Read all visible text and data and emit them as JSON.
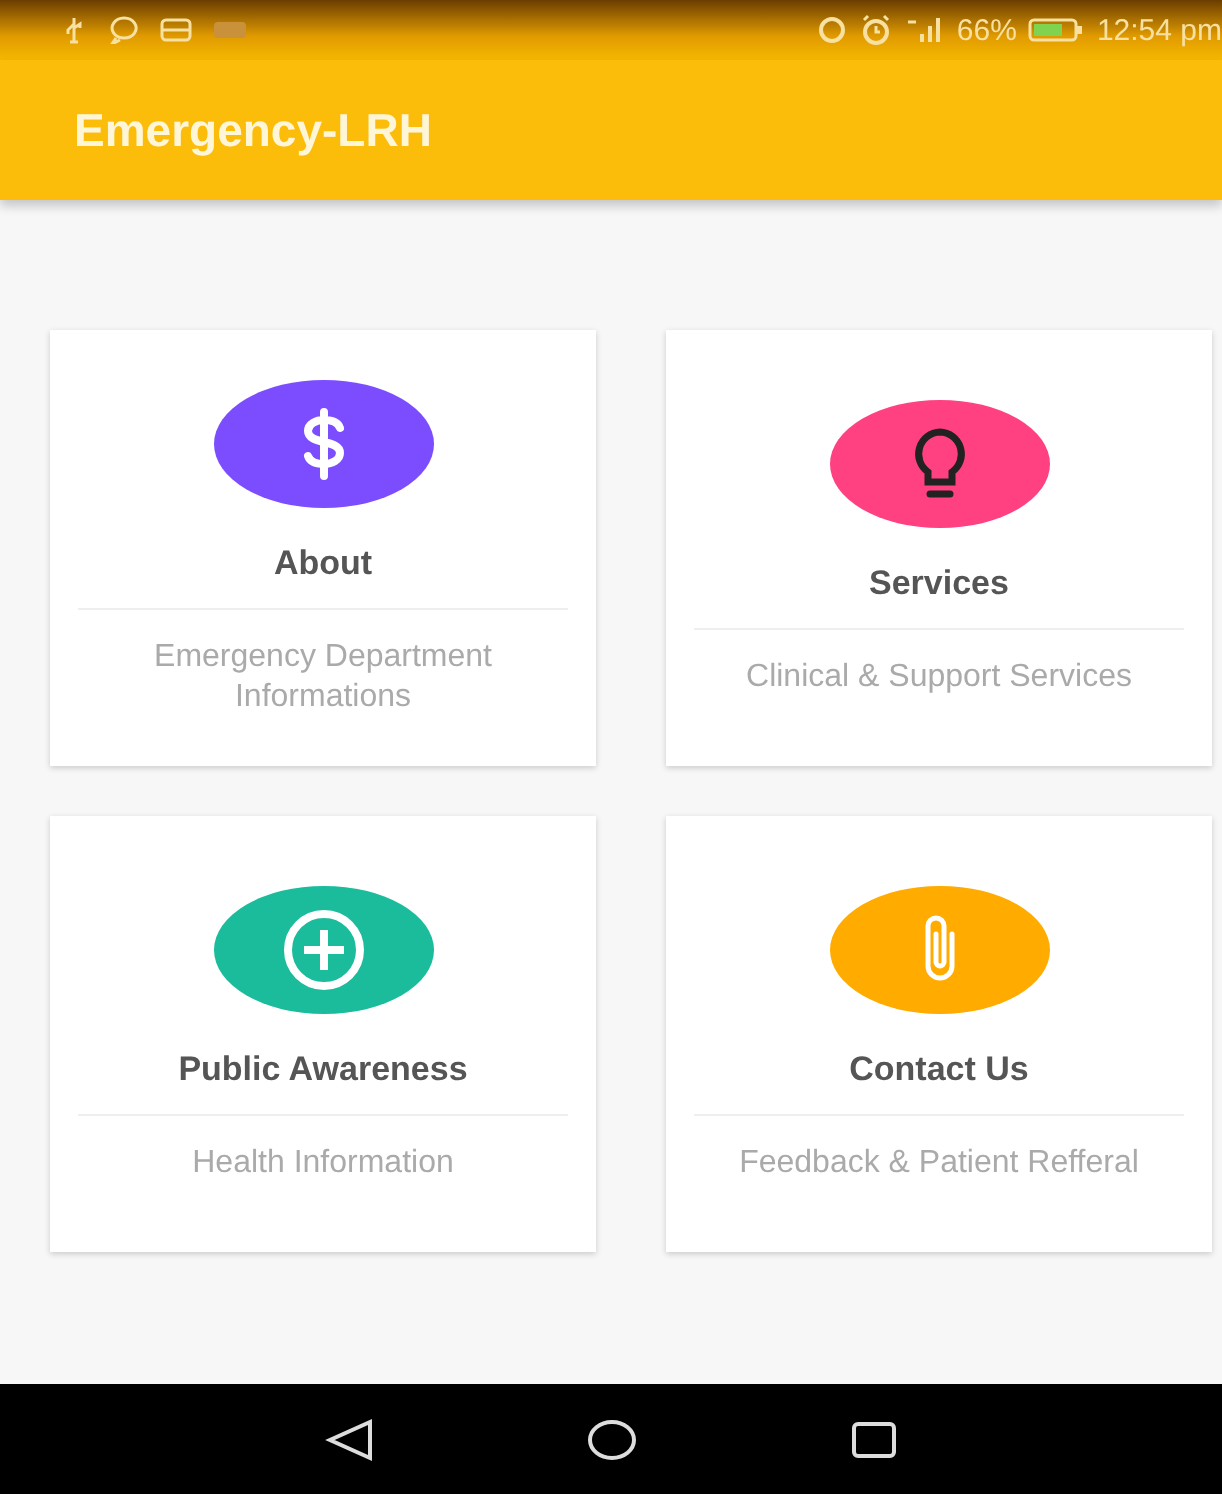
{
  "status_bar": {
    "battery_percent": "66%",
    "time": "12:54 pm"
  },
  "app_bar": {
    "title": "Emergency-LRH"
  },
  "cards": [
    {
      "kind": "dollar",
      "color": "#7c4dff",
      "title": "About",
      "description": "Emergency Department Informations"
    },
    {
      "kind": "bulb",
      "color": "#ff4081",
      "title": "Services",
      "description": "Clinical & Support Services"
    },
    {
      "kind": "plus",
      "color": "#1abc9c",
      "title": "Public Awareness",
      "description": "Health Information"
    },
    {
      "kind": "clip",
      "color": "#ffab00",
      "title": "Contact Us",
      "description": "Feedback & Patient Refferal"
    }
  ]
}
